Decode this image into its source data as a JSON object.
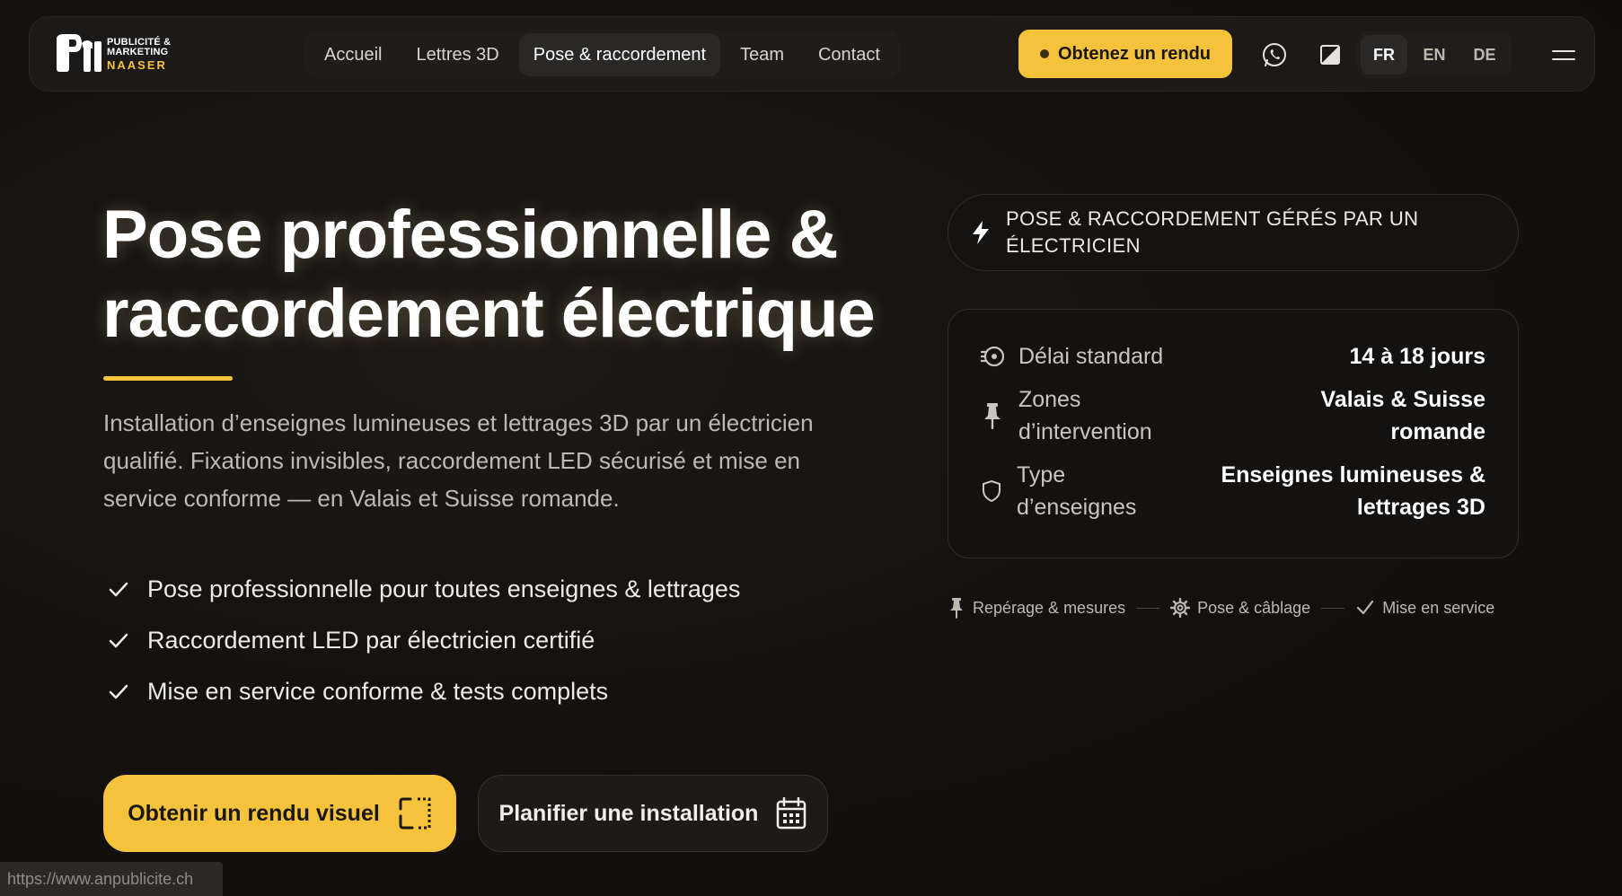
{
  "nav": {
    "logo": {
      "line1": "PUBLICITÉ &",
      "line2": "MARKETING",
      "line3": "NAASER"
    },
    "links": [
      {
        "label": "Accueil"
      },
      {
        "label": "Lettres 3D"
      },
      {
        "label": "Pose & raccordement"
      },
      {
        "label": "Team"
      },
      {
        "label": "Contact"
      }
    ],
    "active_link": "Pose & raccordement",
    "cta": "Obtenez un rendu",
    "languages": [
      "FR",
      "EN",
      "DE"
    ],
    "active_language": "FR",
    "icons": [
      "whatsapp-icon",
      "theme-toggle-icon",
      "menu-icon"
    ]
  },
  "hero": {
    "title_line1": "Pose professionnelle &",
    "title_line2": "raccordement électrique",
    "description": "Installation d’enseignes lumineuses et lettrages 3D par un électricien qualifié. Fixations invisibles, raccordement LED sécurisé et mise en service conforme — en Valais et Suisse romande.",
    "features": [
      "Pose professionnelle pour toutes enseignes & lettrages",
      "Raccordement LED par électricien certifié",
      "Mise en service conforme & tests complets"
    ],
    "primary_button": "Obtenir un rendu visuel",
    "secondary_button": "Planifier une installation"
  },
  "panel": {
    "badge": "POSE & RACCORDEMENT GÉRÉS PAR UN ÉLECTRICIEN",
    "info": [
      {
        "label": "Délai standard",
        "value": "14 à 18 jours",
        "icon": "gauge-icon"
      },
      {
        "label": "Zones d’intervention",
        "value": "Valais & Suisse romande",
        "icon": "pin-icon"
      },
      {
        "label_line1": "Type",
        "label_line2": "d’enseignes",
        "value_line1": "Enseignes lumineuses &",
        "value_line2": "lettrages 3D",
        "icon": "shield-icon"
      }
    ],
    "steps": [
      {
        "label": "Repérage & mesures",
        "icon": "pin-icon"
      },
      {
        "label": "Pose & câblage",
        "icon": "gear-icon"
      },
      {
        "label": "Mise en service",
        "icon": "check-icon"
      }
    ]
  },
  "status_bar": {
    "url": "https://www.anpublicite.ch"
  },
  "colors": {
    "accent": "#f5c33b",
    "background": "#141210",
    "card_border": "#2f2d2a"
  }
}
